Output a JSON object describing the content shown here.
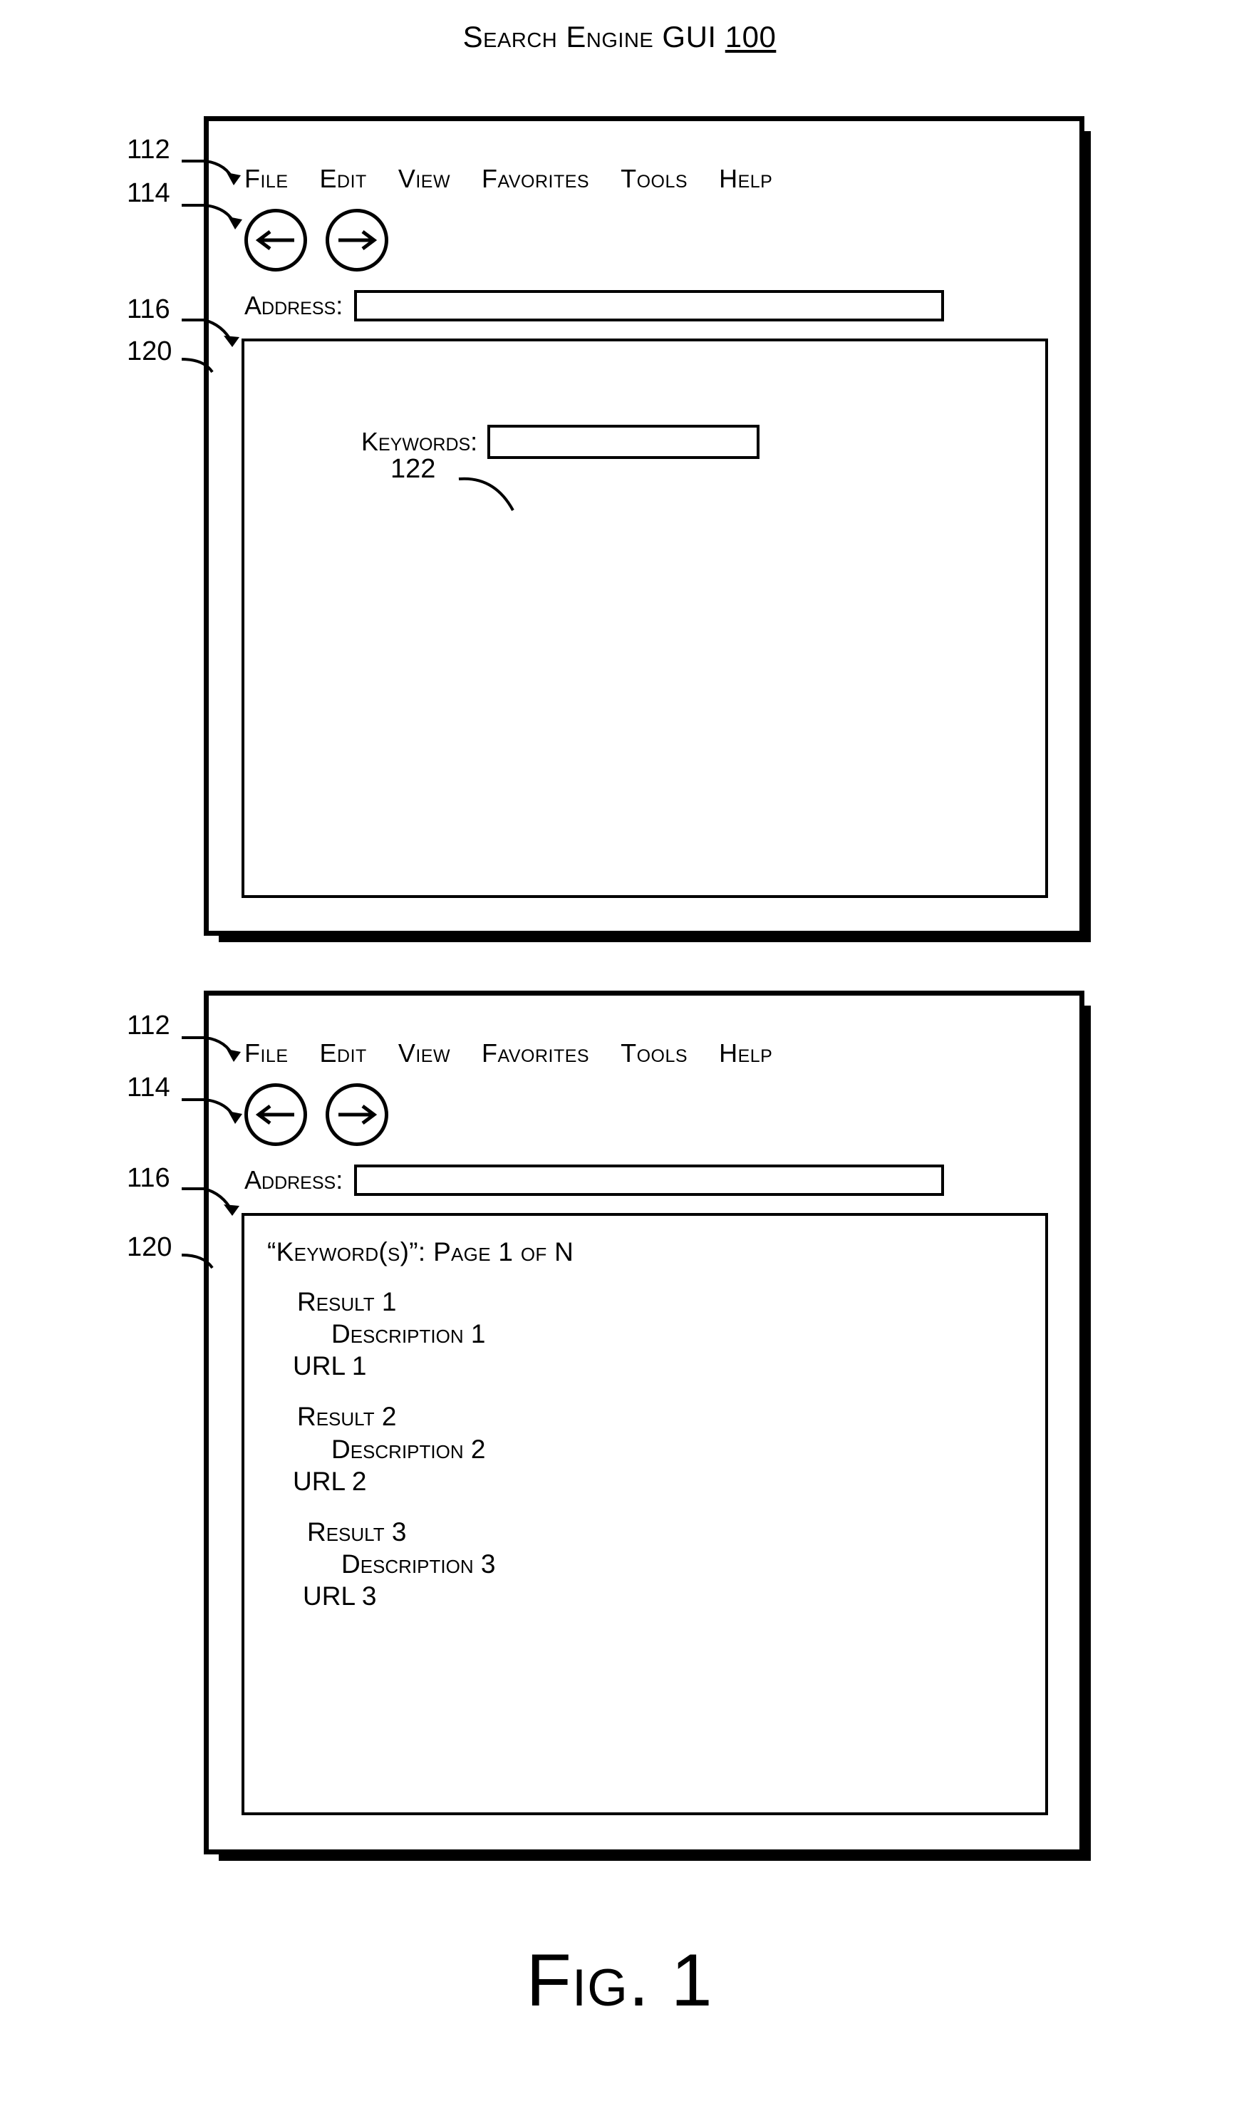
{
  "figure": {
    "title_prefix": "Search Engine",
    "title_plain": "GUI",
    "title_refnum": "100",
    "caption": "Fig. 1"
  },
  "menu": {
    "items": [
      {
        "label": "File"
      },
      {
        "label": "Edit"
      },
      {
        "label": "View"
      },
      {
        "label": "Favorites"
      },
      {
        "label": "Tools"
      },
      {
        "label": "Help"
      }
    ]
  },
  "navigation": {
    "back_icon": "arrow-left-icon",
    "forward_icon": "arrow-right-icon"
  },
  "address_bar": {
    "label": "Address:",
    "value": "",
    "placeholder": ""
  },
  "search_panel": {
    "keywords_label": "Keywords:",
    "keywords_value": "",
    "keywords_placeholder": ""
  },
  "results_panel": {
    "heading": "“Keyword(s)”: Page 1 of N",
    "results": [
      {
        "title": "Result 1",
        "description": "Description 1",
        "url": "URL 1"
      },
      {
        "title": "Result 2",
        "description": "Description 2",
        "url": "URL 2"
      },
      {
        "title": "Result 3",
        "description": "Description 3",
        "url": "URL 3"
      }
    ]
  },
  "callouts": {
    "top_menu": "112",
    "top_nav": "114",
    "top_address": "116",
    "top_content": "120",
    "keywords_field": "122",
    "bottom_menu": "112",
    "bottom_nav": "114",
    "bottom_address": "116",
    "bottom_content": "120"
  }
}
